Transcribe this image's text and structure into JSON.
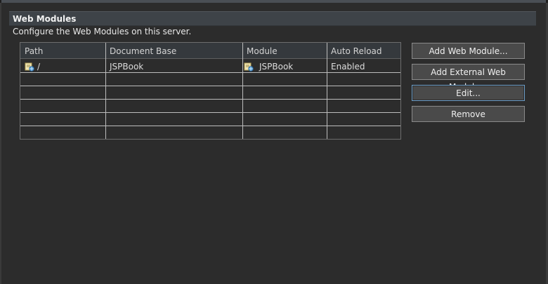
{
  "section": {
    "title": "Web Modules",
    "description": "Configure the Web Modules on this server."
  },
  "table": {
    "columns": [
      "Path",
      "Document Base",
      "Module",
      "Auto Reload"
    ],
    "rows": [
      {
        "path": "/",
        "document_base": "JSPBook",
        "module": "JSPBook",
        "auto_reload": "Enabled"
      }
    ],
    "icons": {
      "path_icon": "web-module-icon",
      "module_icon": "web-module-icon"
    }
  },
  "buttons": {
    "add_web_module": "Add Web Module...",
    "add_external_web_module": "Add External Web Module...",
    "edit": "Edit...",
    "remove": "Remove"
  },
  "colors": {
    "background": "#2c2c2c",
    "header_bar": "#3e4348",
    "focus_border": "#6d9ec8"
  }
}
